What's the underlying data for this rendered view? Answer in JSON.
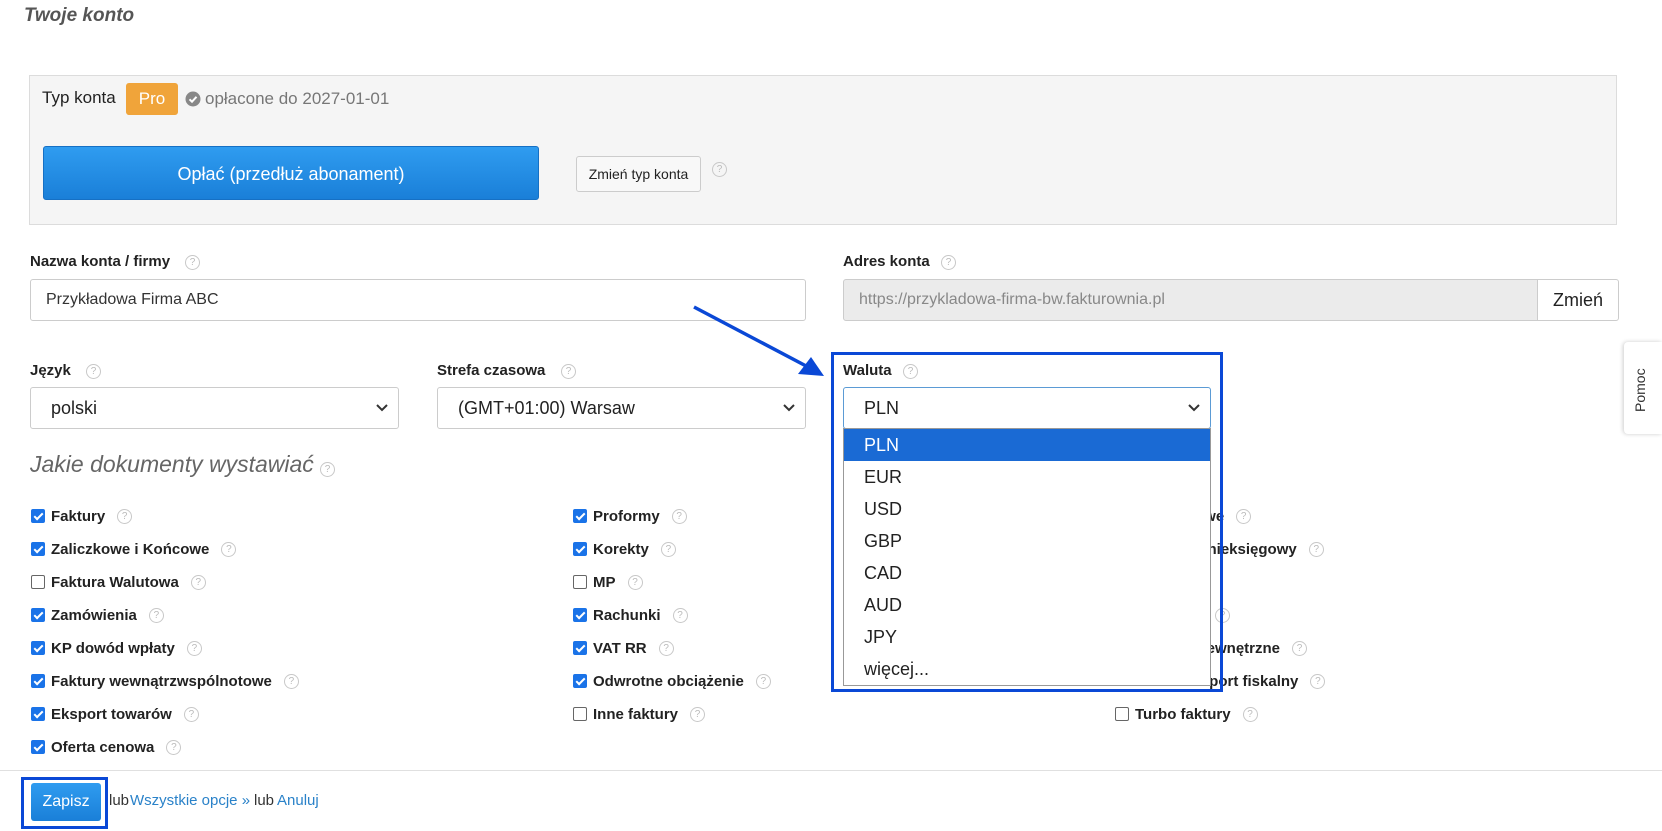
{
  "page": {
    "title": "Twoje konto"
  },
  "account": {
    "type_label": "Typ konta",
    "badge": "Pro",
    "paid_until": "opłacone do 2027-01-01",
    "pay_button": "Opłać (przedłuż abonament)",
    "change_type_button": "Zmień typ konta"
  },
  "fields": {
    "company_label": "Nazwa konta / firmy",
    "company_value": "Przykładowa Firma ABC",
    "address_label": "Adres konta",
    "address_value": "https://przykladowa-firma-bw.fakturownia.pl",
    "address_change": "Zmień",
    "language_label": "Język",
    "language_value": "polski",
    "timezone_label": "Strefa czasowa",
    "timezone_value": "(GMT+01:00) Warsaw",
    "currency_label": "Waluta",
    "currency_value": "PLN"
  },
  "currency_options": [
    "PLN",
    "EUR",
    "USD",
    "GBP",
    "CAD",
    "AUD",
    "JPY",
    "więcej..."
  ],
  "documents": {
    "title": "Jakie dokumenty wystawiać",
    "col1": [
      {
        "label": "Faktury",
        "checked": true
      },
      {
        "label": "Zaliczkowe i Końcowe",
        "checked": true
      },
      {
        "label": "Faktura Walutowa",
        "checked": false
      },
      {
        "label": "Zamówienia",
        "checked": true
      },
      {
        "label": "KP dowód wpłaty",
        "checked": true
      },
      {
        "label": "Faktury wewnątrzwspólnotowe",
        "checked": true
      },
      {
        "label": "Eksport towarów",
        "checked": true
      },
      {
        "label": "Oferta cenowa",
        "checked": true
      }
    ],
    "col2": [
      {
        "label": "Proformy",
        "checked": true
      },
      {
        "label": "Korekty",
        "checked": true
      },
      {
        "label": "MP",
        "checked": false
      },
      {
        "label": "Rachunki",
        "checked": true
      },
      {
        "label": "VAT RR",
        "checked": true
      },
      {
        "label": "Odwrotne obciążenie",
        "checked": true
      },
      {
        "label": "Inne faktury",
        "checked": false
      }
    ],
    "col3_partial": [
      {
        "label": "owe"
      },
      {
        "label": "k nieksięgowy"
      },
      {
        "label": ""
      },
      {
        "label": ""
      },
      {
        "label": "wewnętrzne"
      },
      {
        "label": "raport fiskalny"
      }
    ],
    "col3_turbo": {
      "label": "Turbo faktury",
      "checked": false
    }
  },
  "footer": {
    "save": "Zapisz",
    "or1": "lub",
    "all_options": "Wszystkie opcje »",
    "or2": "lub",
    "cancel": "Anuluj"
  },
  "side_tab": {
    "label": "Pomoc"
  },
  "colors": {
    "accent": "#1a7fd8",
    "badge": "#f0a43a",
    "highlight": "#0a48d6"
  }
}
